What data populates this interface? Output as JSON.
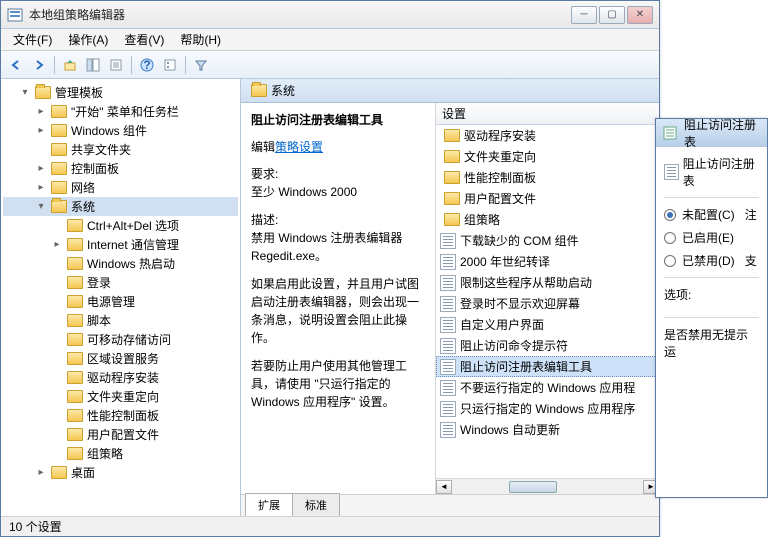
{
  "window": {
    "title": "本地组策略编辑器"
  },
  "menus": [
    "文件(F)",
    "操作(A)",
    "查看(V)",
    "帮助(H)"
  ],
  "tree": [
    {
      "lvl": 1,
      "exp": "▾",
      "label": "管理模板",
      "open": true
    },
    {
      "lvl": 2,
      "exp": "▸",
      "label": "\"开始\" 菜单和任务栏"
    },
    {
      "lvl": 2,
      "exp": "▸",
      "label": "Windows 组件"
    },
    {
      "lvl": 2,
      "exp": "",
      "label": "共享文件夹"
    },
    {
      "lvl": 2,
      "exp": "▸",
      "label": "控制面板"
    },
    {
      "lvl": 2,
      "exp": "▸",
      "label": "网络"
    },
    {
      "lvl": 2,
      "exp": "▾",
      "label": "系统",
      "open": true,
      "sel": true
    },
    {
      "lvl": 3,
      "exp": "",
      "label": "Ctrl+Alt+Del 选项"
    },
    {
      "lvl": 3,
      "exp": "▸",
      "label": "Internet 通信管理"
    },
    {
      "lvl": 3,
      "exp": "",
      "label": "Windows 热启动"
    },
    {
      "lvl": 3,
      "exp": "",
      "label": "登录"
    },
    {
      "lvl": 3,
      "exp": "",
      "label": "电源管理"
    },
    {
      "lvl": 3,
      "exp": "",
      "label": "脚本"
    },
    {
      "lvl": 3,
      "exp": "",
      "label": "可移动存储访问"
    },
    {
      "lvl": 3,
      "exp": "",
      "label": "区域设置服务"
    },
    {
      "lvl": 3,
      "exp": "",
      "label": "驱动程序安装"
    },
    {
      "lvl": 3,
      "exp": "",
      "label": "文件夹重定向"
    },
    {
      "lvl": 3,
      "exp": "",
      "label": "性能控制面板"
    },
    {
      "lvl": 3,
      "exp": "",
      "label": "用户配置文件"
    },
    {
      "lvl": 3,
      "exp": "",
      "label": "组策略"
    },
    {
      "lvl": 2,
      "exp": "▸",
      "label": "桌面"
    }
  ],
  "path": {
    "label": "系统"
  },
  "desc": {
    "heading": "阻止访问注册表编辑工具",
    "edit_prefix": "编辑",
    "edit_link": "策略设置",
    "req_label": "要求:",
    "req_value": "至少 Windows 2000",
    "desc_label": "描述:",
    "desc_value": "禁用 Windows 注册表编辑器 Regedit.exe。",
    "p1": "如果启用此设置，并且用户试图启动注册表编辑器，则会出现一条消息，说明设置会阻止此操作。",
    "p2": "若要防止用户使用其他管理工具，请使用 \"只运行指定的 Windows 应用程序\" 设置。"
  },
  "list_header": "设置",
  "list": [
    {
      "t": "folder",
      "label": "驱动程序安装"
    },
    {
      "t": "folder",
      "label": "文件夹重定向"
    },
    {
      "t": "folder",
      "label": "性能控制面板"
    },
    {
      "t": "folder",
      "label": "用户配置文件"
    },
    {
      "t": "folder",
      "label": "组策略"
    },
    {
      "t": "policy",
      "label": "下载缺少的 COM 组件"
    },
    {
      "t": "policy",
      "label": "2000 年世纪转译"
    },
    {
      "t": "policy",
      "label": "限制这些程序从帮助启动"
    },
    {
      "t": "policy",
      "label": "登录时不显示欢迎屏幕"
    },
    {
      "t": "policy",
      "label": "自定义用户界面"
    },
    {
      "t": "policy",
      "label": "阻止访问命令提示符"
    },
    {
      "t": "policy",
      "label": "阻止访问注册表编辑工具",
      "sel": true
    },
    {
      "t": "policy",
      "label": "不要运行指定的 Windows 应用程"
    },
    {
      "t": "policy",
      "label": "只运行指定的 Windows 应用程序"
    },
    {
      "t": "policy",
      "label": "Windows 自动更新"
    }
  ],
  "tabs": {
    "t1": "扩展",
    "t2": "标准"
  },
  "status": "10 个设置",
  "dialog": {
    "title": "阻止访问注册表",
    "header": "阻止访问注册表",
    "r1": "未配置(C)",
    "r2": "已启用(E)",
    "r3": "已禁用(D)",
    "note": "注",
    "opts": "选项:",
    "q": "是否禁用无提示运",
    "support": "支"
  }
}
